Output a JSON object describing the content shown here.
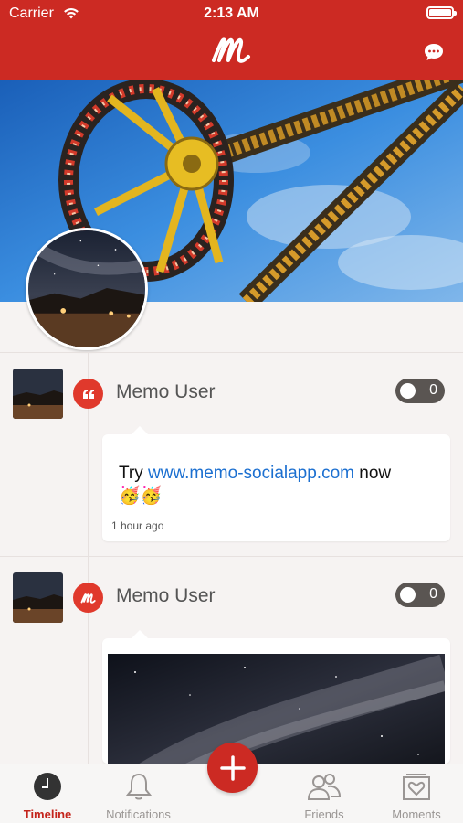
{
  "status_bar": {
    "carrier": "Carrier",
    "time": "2:13 AM"
  },
  "nav": {
    "logo": "M"
  },
  "posts": [
    {
      "user": "Memo User",
      "text_prefix": "Try ",
      "link": "www.memo-socialapp.com",
      "text_suffix": " now",
      "emoji": "🥳🥳",
      "time": "1 hour ago",
      "count": "0",
      "type_icon": "quote-icon"
    },
    {
      "user": "Memo User",
      "count": "0",
      "type_icon": "memo-logo-icon"
    }
  ],
  "add_symbol": "+",
  "tabs": [
    {
      "label": "Timeline",
      "icon": "clock-icon",
      "active": true
    },
    {
      "label": "Notifications",
      "icon": "bell-icon",
      "active": false
    },
    {
      "label": "Friends",
      "icon": "friends-icon",
      "active": false
    },
    {
      "label": "Moments",
      "icon": "moments-icon",
      "active": false
    }
  ],
  "colors": {
    "brand": "#cc2a23",
    "link": "#1b6fd0",
    "active_tab": "#c4241b"
  }
}
